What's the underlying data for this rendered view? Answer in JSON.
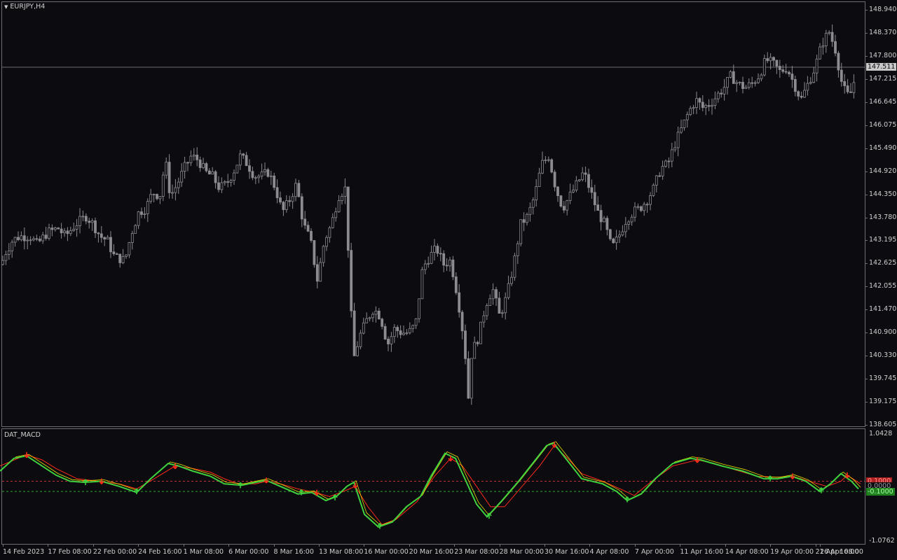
{
  "chart": {
    "symbol_label": "EURJPY,H4",
    "current_price": "147.511",
    "price_labels": [
      "148.940",
      "148.370",
      "147.800",
      "147.215",
      "146.645",
      "146.075",
      "145.490",
      "144.920",
      "144.350",
      "143.780",
      "143.195",
      "142.625",
      "142.055",
      "141.470",
      "140.900",
      "140.330",
      "139.745",
      "139.175",
      "138.605"
    ],
    "date_labels": [
      "14 Feb 2023",
      "17 Feb 08:00",
      "22 Feb 00:00",
      "24 Feb 16:00",
      "1 Mar 08:00",
      "6 Mar 00:00",
      "8 Mar 16:00",
      "13 Mar 08:00",
      "16 Mar 00:00",
      "20 Mar 16:00",
      "23 Mar 08:00",
      "28 Mar 00:00",
      "30 Mar 16:00",
      "4 Apr 08:00",
      "7 Apr 00:00",
      "11 Apr 16:00",
      "14 Apr 08:00",
      "19 Apr 00:00",
      "21 Apr 16:00",
      "26 Apr 08:00"
    ],
    "colors": {
      "background": "#0b0b10",
      "candle": "#8c8c90",
      "grid_line": "#6c6c72",
      "macd": "#3fd13f",
      "signal": "#ff2a1a",
      "accent_yellow": "#e8e000",
      "level_red": "#ff4040",
      "level_green": "#30c030"
    }
  },
  "indicator": {
    "name": "DAT_MACD",
    "max_label": "1.0428",
    "min_label": "-1.0762",
    "upper_level": "0.1000",
    "zero_level": "0.0000",
    "lower_level": "-0.1000"
  },
  "chart_data": {
    "type": "candlestick",
    "title": "EURJPY,H4",
    "ylim": [
      138.605,
      148.94
    ],
    "x_start": "14 Feb 2023",
    "x_end": "26 Apr 08:00",
    "path_points": [
      [
        0,
        142.4
      ],
      [
        10,
        142.9
      ],
      [
        20,
        143.2
      ],
      [
        30,
        143.3
      ],
      [
        45,
        143.3
      ],
      [
        55,
        143.1
      ],
      [
        70,
        143.4
      ],
      [
        85,
        143.5
      ],
      [
        95,
        143.3
      ],
      [
        110,
        143.6
      ],
      [
        125,
        143.8
      ],
      [
        135,
        143.6
      ],
      [
        145,
        143.3
      ],
      [
        155,
        143.2
      ],
      [
        165,
        142.8
      ],
      [
        180,
        142.7
      ],
      [
        190,
        143.4
      ],
      [
        200,
        143.9
      ],
      [
        210,
        144.0
      ],
      [
        220,
        144.4
      ],
      [
        230,
        144.3
      ],
      [
        238,
        145.2
      ],
      [
        245,
        144.3
      ],
      [
        255,
        144.6
      ],
      [
        265,
        145.0
      ],
      [
        275,
        145.3
      ],
      [
        285,
        145.2
      ],
      [
        295,
        144.9
      ],
      [
        305,
        144.8
      ],
      [
        315,
        144.5
      ],
      [
        325,
        144.6
      ],
      [
        335,
        144.9
      ],
      [
        345,
        145.3
      ],
      [
        355,
        145.1
      ],
      [
        365,
        144.8
      ],
      [
        375,
        144.8
      ],
      [
        385,
        144.9
      ],
      [
        395,
        144.5
      ],
      [
        405,
        143.9
      ],
      [
        415,
        144.2
      ],
      [
        425,
        144.6
      ],
      [
        435,
        143.6
      ],
      [
        445,
        143.2
      ],
      [
        455,
        142.2
      ],
      [
        465,
        143.2
      ],
      [
        475,
        143.6
      ],
      [
        485,
        144.3
      ],
      [
        495,
        144.5
      ],
      [
        502,
        141.8
      ],
      [
        506,
        140.2
      ],
      [
        515,
        140.8
      ],
      [
        525,
        141.2
      ],
      [
        535,
        141.5
      ],
      [
        545,
        141.3
      ],
      [
        555,
        140.6
      ],
      [
        565,
        141.0
      ],
      [
        575,
        140.9
      ],
      [
        585,
        140.9
      ],
      [
        595,
        141.1
      ],
      [
        605,
        142.5
      ],
      [
        615,
        142.8
      ],
      [
        625,
        143.0
      ],
      [
        635,
        142.6
      ],
      [
        645,
        142.7
      ],
      [
        655,
        141.8
      ],
      [
        665,
        140.6
      ],
      [
        670,
        139.2
      ],
      [
        675,
        140.4
      ],
      [
        685,
        140.8
      ],
      [
        695,
        141.6
      ],
      [
        705,
        142.0
      ],
      [
        715,
        141.3
      ],
      [
        725,
        141.8
      ],
      [
        735,
        142.6
      ],
      [
        745,
        143.6
      ],
      [
        755,
        143.8
      ],
      [
        765,
        144.3
      ],
      [
        775,
        145.1
      ],
      [
        785,
        145.3
      ],
      [
        795,
        144.5
      ],
      [
        805,
        144.0
      ],
      [
        815,
        144.3
      ],
      [
        825,
        144.6
      ],
      [
        835,
        144.9
      ],
      [
        845,
        144.4
      ],
      [
        855,
        143.9
      ],
      [
        865,
        143.6
      ],
      [
        875,
        143.0
      ],
      [
        885,
        143.3
      ],
      [
        895,
        143.7
      ],
      [
        905,
        143.9
      ],
      [
        915,
        144.0
      ],
      [
        925,
        144.2
      ],
      [
        935,
        144.5
      ],
      [
        945,
        145.0
      ],
      [
        955,
        145.1
      ],
      [
        965,
        145.6
      ],
      [
        975,
        146.0
      ],
      [
        985,
        146.4
      ],
      [
        995,
        146.7
      ],
      [
        1005,
        146.5
      ],
      [
        1015,
        146.6
      ],
      [
        1025,
        146.8
      ],
      [
        1035,
        147.0
      ],
      [
        1045,
        147.3
      ],
      [
        1055,
        147.1
      ],
      [
        1065,
        147.0
      ],
      [
        1075,
        147.1
      ],
      [
        1085,
        147.3
      ],
      [
        1095,
        147.7
      ],
      [
        1105,
        147.6
      ],
      [
        1115,
        147.4
      ],
      [
        1125,
        147.5
      ],
      [
        1135,
        147.1
      ],
      [
        1145,
        146.7
      ],
      [
        1155,
        147.1
      ],
      [
        1165,
        147.5
      ],
      [
        1175,
        148.1
      ],
      [
        1185,
        148.4
      ],
      [
        1195,
        147.9
      ],
      [
        1202,
        147.2
      ],
      [
        1210,
        146.8
      ],
      [
        1218,
        146.9
      ],
      [
        1224,
        147.5
      ]
    ],
    "macd_series_points": [
      [
        0,
        0.3
      ],
      [
        20,
        0.55
      ],
      [
        38,
        0.6
      ],
      [
        60,
        0.4
      ],
      [
        80,
        0.22
      ],
      [
        100,
        0.1
      ],
      [
        120,
        0.08
      ],
      [
        145,
        0.1
      ],
      [
        170,
        0.0
      ],
      [
        195,
        -0.12
      ],
      [
        215,
        0.15
      ],
      [
        240,
        0.45
      ],
      [
        255,
        0.4
      ],
      [
        275,
        0.3
      ],
      [
        300,
        0.2
      ],
      [
        320,
        0.05
      ],
      [
        345,
        0.02
      ],
      [
        365,
        0.08
      ],
      [
        380,
        0.12
      ],
      [
        400,
        0.0
      ],
      [
        425,
        -0.15
      ],
      [
        445,
        -0.12
      ],
      [
        465,
        -0.28
      ],
      [
        480,
        -0.2
      ],
      [
        495,
        0.0
      ],
      [
        505,
        0.08
      ],
      [
        520,
        -0.55
      ],
      [
        540,
        -0.8
      ],
      [
        560,
        -0.7
      ],
      [
        580,
        -0.4
      ],
      [
        600,
        -0.2
      ],
      [
        615,
        0.2
      ],
      [
        635,
        0.65
      ],
      [
        650,
        0.55
      ],
      [
        665,
        0.1
      ],
      [
        680,
        -0.35
      ],
      [
        695,
        -0.6
      ],
      [
        715,
        -0.3
      ],
      [
        740,
        0.1
      ],
      [
        760,
        0.45
      ],
      [
        780,
        0.8
      ],
      [
        790,
        0.85
      ],
      [
        810,
        0.5
      ],
      [
        830,
        0.15
      ],
      [
        860,
        0.05
      ],
      [
        880,
        -0.1
      ],
      [
        895,
        -0.28
      ],
      [
        915,
        -0.15
      ],
      [
        935,
        0.15
      ],
      [
        960,
        0.45
      ],
      [
        985,
        0.55
      ],
      [
        1000,
        0.52
      ],
      [
        1030,
        0.4
      ],
      [
        1060,
        0.3
      ],
      [
        1090,
        0.15
      ],
      [
        1110,
        0.15
      ],
      [
        1130,
        0.2
      ],
      [
        1150,
        0.1
      ],
      [
        1170,
        -0.1
      ],
      [
        1185,
        0.05
      ],
      [
        1200,
        0.25
      ],
      [
        1215,
        0.1
      ],
      [
        1225,
        -0.05
      ]
    ],
    "signal_series_points": [
      [
        0,
        0.4
      ],
      [
        38,
        0.62
      ],
      [
        60,
        0.52
      ],
      [
        80,
        0.35
      ],
      [
        110,
        0.15
      ],
      [
        140,
        0.1
      ],
      [
        170,
        0.05
      ],
      [
        195,
        -0.05
      ],
      [
        220,
        0.15
      ],
      [
        250,
        0.4
      ],
      [
        275,
        0.35
      ],
      [
        300,
        0.28
      ],
      [
        320,
        0.15
      ],
      [
        340,
        0.05
      ],
      [
        365,
        0.05
      ],
      [
        380,
        0.1
      ],
      [
        400,
        0.05
      ],
      [
        425,
        -0.05
      ],
      [
        450,
        -0.12
      ],
      [
        470,
        -0.2
      ],
      [
        490,
        -0.1
      ],
      [
        507,
        0.0
      ],
      [
        525,
        -0.4
      ],
      [
        545,
        -0.75
      ],
      [
        565,
        -0.65
      ],
      [
        595,
        -0.3
      ],
      [
        620,
        0.2
      ],
      [
        643,
        0.55
      ],
      [
        660,
        0.4
      ],
      [
        680,
        0.0
      ],
      [
        700,
        -0.4
      ],
      [
        720,
        -0.4
      ],
      [
        745,
        0.0
      ],
      [
        770,
        0.4
      ],
      [
        791,
        0.8
      ],
      [
        810,
        0.55
      ],
      [
        830,
        0.25
      ],
      [
        860,
        0.1
      ],
      [
        885,
        -0.05
      ],
      [
        905,
        -0.18
      ],
      [
        930,
        0.1
      ],
      [
        960,
        0.4
      ],
      [
        995,
        0.52
      ],
      [
        1020,
        0.45
      ],
      [
        1050,
        0.32
      ],
      [
        1080,
        0.2
      ],
      [
        1110,
        0.18
      ],
      [
        1131,
        0.2
      ],
      [
        1155,
        0.1
      ],
      [
        1180,
        0.0
      ],
      [
        1200,
        0.1
      ],
      [
        1209,
        0.22
      ],
      [
        1228,
        0.05
      ]
    ],
    "macd_ylim": [
      -1.0762,
      1.0428
    ]
  }
}
